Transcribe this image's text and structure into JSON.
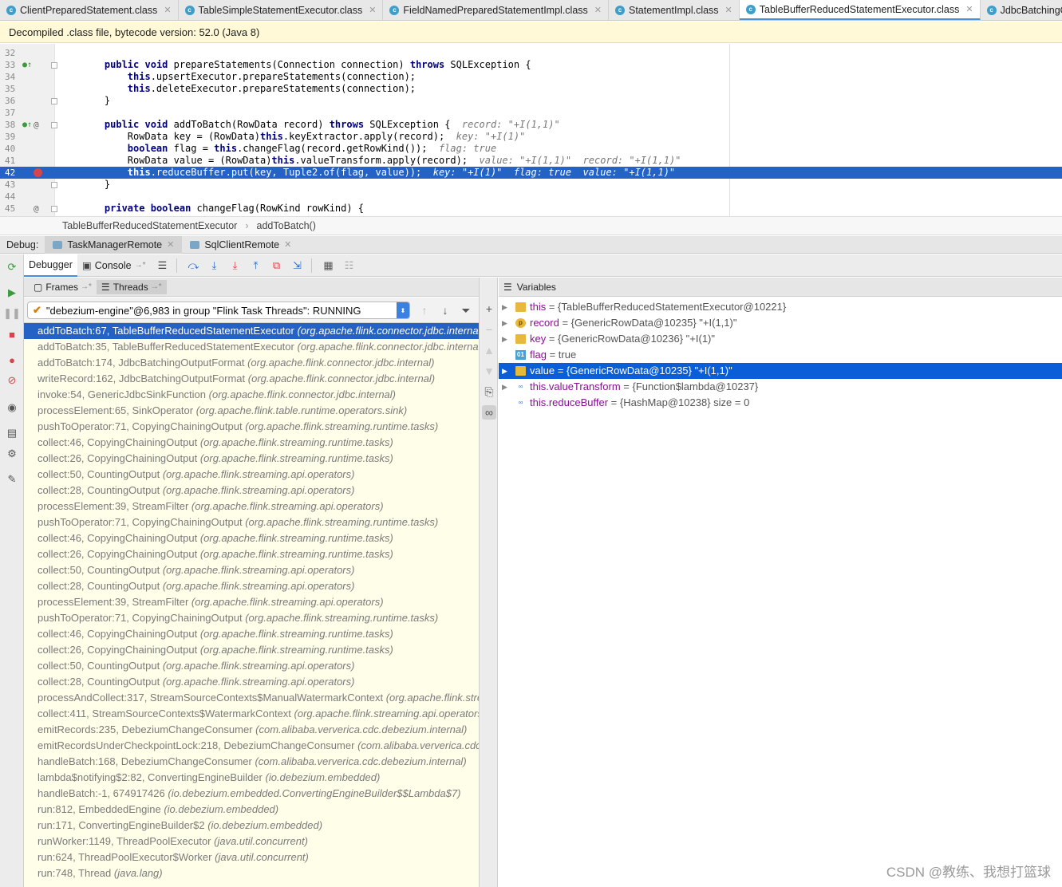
{
  "tabs": [
    {
      "label": "ClientPreparedStatement.class",
      "active": false
    },
    {
      "label": "TableSimpleStatementExecutor.class",
      "active": false
    },
    {
      "label": "FieldNamedPreparedStatementImpl.class",
      "active": false
    },
    {
      "label": "StatementImpl.class",
      "active": false
    },
    {
      "label": "TableBufferReducedStatementExecutor.class",
      "active": true
    },
    {
      "label": "JdbcBatchingOutputFormat.class",
      "active": false
    }
  ],
  "banner": "Decompiled .class file, bytecode version: 52.0 (Java 8)",
  "editor": {
    "lines": [
      {
        "num": "32",
        "code": ""
      },
      {
        "num": "33",
        "code": "    public void prepareStatements(Connection connection) throws SQLException {"
      },
      {
        "num": "34",
        "code": "        this.upsertExecutor.prepareStatements(connection);"
      },
      {
        "num": "35",
        "code": "        this.deleteExecutor.prepareStatements(connection);"
      },
      {
        "num": "36",
        "code": "    }"
      },
      {
        "num": "37",
        "code": ""
      },
      {
        "num": "38",
        "code": "    public void addToBatch(RowData record) throws SQLException {",
        "hint": "  record: \"+I(1,1)\""
      },
      {
        "num": "39",
        "code": "        RowData key = (RowData)this.keyExtractor.apply(record);",
        "hint": "  key: \"+I(1)\""
      },
      {
        "num": "40",
        "code": "        boolean flag = this.changeFlag(record.getRowKind());",
        "hint": "  flag: true"
      },
      {
        "num": "41",
        "code": "        RowData value = (RowData)this.valueTransform.apply(record);",
        "hint": "  value: \"+I(1,1)\"  record: \"+I(1,1)\""
      },
      {
        "num": "42",
        "code": "        this.reduceBuffer.put(key, Tuple2.of(flag, value));",
        "hint": "  key: \"+I(1)\"  flag: true  value: \"+I(1,1)\""
      },
      {
        "num": "43",
        "code": "    }"
      },
      {
        "num": "44",
        "code": ""
      },
      {
        "num": "45",
        "code": "    private boolean changeFlag(RowKind rowKind) {"
      }
    ]
  },
  "breadcrumb": [
    "TableBufferReducedStatementExecutor",
    "addToBatch()"
  ],
  "debug": {
    "label": "Debug:",
    "sessions": [
      {
        "label": "TaskManagerRemote",
        "active": true
      },
      {
        "label": "SqlClientRemote",
        "active": false
      }
    ],
    "debugger_tab": "Debugger",
    "console_tab": "Console",
    "frames_tab": "Frames",
    "threads_tab": "Threads",
    "thread_selector": "\"debezium-engine\"@6,983 in group \"Flink Task Threads\": RUNNING"
  },
  "frames": [
    {
      "method": "addToBatch:67, TableBufferReducedStatementExecutor",
      "pkg": "(org.apache.flink.connector.jdbc.internal.executor)"
    },
    {
      "method": "addToBatch:35, TableBufferReducedStatementExecutor",
      "pkg": "(org.apache.flink.connector.jdbc.internal.executor)"
    },
    {
      "method": "addToBatch:174, JdbcBatchingOutputFormat",
      "pkg": "(org.apache.flink.connector.jdbc.internal)"
    },
    {
      "method": "writeRecord:162, JdbcBatchingOutputFormat",
      "pkg": "(org.apache.flink.connector.jdbc.internal)"
    },
    {
      "method": "invoke:54, GenericJdbcSinkFunction",
      "pkg": "(org.apache.flink.connector.jdbc.internal)"
    },
    {
      "method": "processElement:65, SinkOperator",
      "pkg": "(org.apache.flink.table.runtime.operators.sink)"
    },
    {
      "method": "pushToOperator:71, CopyingChainingOutput",
      "pkg": "(org.apache.flink.streaming.runtime.tasks)"
    },
    {
      "method": "collect:46, CopyingChainingOutput",
      "pkg": "(org.apache.flink.streaming.runtime.tasks)"
    },
    {
      "method": "collect:26, CopyingChainingOutput",
      "pkg": "(org.apache.flink.streaming.runtime.tasks)"
    },
    {
      "method": "collect:50, CountingOutput",
      "pkg": "(org.apache.flink.streaming.api.operators)"
    },
    {
      "method": "collect:28, CountingOutput",
      "pkg": "(org.apache.flink.streaming.api.operators)"
    },
    {
      "method": "processElement:39, StreamFilter",
      "pkg": "(org.apache.flink.streaming.api.operators)"
    },
    {
      "method": "pushToOperator:71, CopyingChainingOutput",
      "pkg": "(org.apache.flink.streaming.runtime.tasks)"
    },
    {
      "method": "collect:46, CopyingChainingOutput",
      "pkg": "(org.apache.flink.streaming.runtime.tasks)"
    },
    {
      "method": "collect:26, CopyingChainingOutput",
      "pkg": "(org.apache.flink.streaming.runtime.tasks)"
    },
    {
      "method": "collect:50, CountingOutput",
      "pkg": "(org.apache.flink.streaming.api.operators)"
    },
    {
      "method": "collect:28, CountingOutput",
      "pkg": "(org.apache.flink.streaming.api.operators)"
    },
    {
      "method": "processElement:39, StreamFilter",
      "pkg": "(org.apache.flink.streaming.api.operators)"
    },
    {
      "method": "pushToOperator:71, CopyingChainingOutput",
      "pkg": "(org.apache.flink.streaming.runtime.tasks)"
    },
    {
      "method": "collect:46, CopyingChainingOutput",
      "pkg": "(org.apache.flink.streaming.runtime.tasks)"
    },
    {
      "method": "collect:26, CopyingChainingOutput",
      "pkg": "(org.apache.flink.streaming.runtime.tasks)"
    },
    {
      "method": "collect:50, CountingOutput",
      "pkg": "(org.apache.flink.streaming.api.operators)"
    },
    {
      "method": "collect:28, CountingOutput",
      "pkg": "(org.apache.flink.streaming.api.operators)"
    },
    {
      "method": "processAndCollect:317, StreamSourceContexts$ManualWatermarkContext",
      "pkg": "(org.apache.flink.streaming.api.operators)"
    },
    {
      "method": "collect:411, StreamSourceContexts$WatermarkContext",
      "pkg": "(org.apache.flink.streaming.api.operators)"
    },
    {
      "method": "emitRecords:235, DebeziumChangeConsumer",
      "pkg": "(com.alibaba.ververica.cdc.debezium.internal)"
    },
    {
      "method": "emitRecordsUnderCheckpointLock:218, DebeziumChangeConsumer",
      "pkg": "(com.alibaba.ververica.cdc.debezium.internal)"
    },
    {
      "method": "handleBatch:168, DebeziumChangeConsumer",
      "pkg": "(com.alibaba.ververica.cdc.debezium.internal)"
    },
    {
      "method": "lambda$notifying$2:82, ConvertingEngineBuilder",
      "pkg": "(io.debezium.embedded)"
    },
    {
      "method": "handleBatch:-1, 674917426",
      "pkg": "(io.debezium.embedded.ConvertingEngineBuilder$$Lambda$7)"
    },
    {
      "method": "run:812, EmbeddedEngine",
      "pkg": "(io.debezium.embedded)"
    },
    {
      "method": "run:171, ConvertingEngineBuilder$2",
      "pkg": "(io.debezium.embedded)"
    },
    {
      "method": "runWorker:1149, ThreadPoolExecutor",
      "pkg": "(java.util.concurrent)"
    },
    {
      "method": "run:624, ThreadPoolExecutor$Worker",
      "pkg": "(java.util.concurrent)"
    },
    {
      "method": "run:748, Thread",
      "pkg": "(java.lang)"
    }
  ],
  "variables": {
    "title": "Variables",
    "items": [
      {
        "name": "this",
        "value": " = {TableBufferReducedStatementExecutor@10221}",
        "icon": "field-icon",
        "expandable": true
      },
      {
        "name": "record",
        "value": " = {GenericRowData@10235} \"+I(1,1)\"",
        "icon": "parameter-icon",
        "expandable": true
      },
      {
        "name": "key",
        "value": " = {GenericRowData@10236} \"+I(1)\"",
        "icon": "field-icon",
        "expandable": true
      },
      {
        "name": "flag",
        "value": " = true",
        "icon": "primitive-icon",
        "expandable": false
      },
      {
        "name": "value",
        "value": " = {GenericRowData@10235} \"+I(1,1)\"",
        "icon": "field-icon",
        "expandable": true,
        "selected": true
      },
      {
        "name": "this.valueTransform",
        "value": " = {Function$lambda@10237}",
        "icon": "watch-icon",
        "expandable": true
      },
      {
        "name": "this.reduceBuffer",
        "value": " = {HashMap@10238}  size = 0",
        "icon": "watch-icon",
        "expandable": false
      }
    ]
  },
  "watermark": "CSDN @教练、我想打篮球"
}
